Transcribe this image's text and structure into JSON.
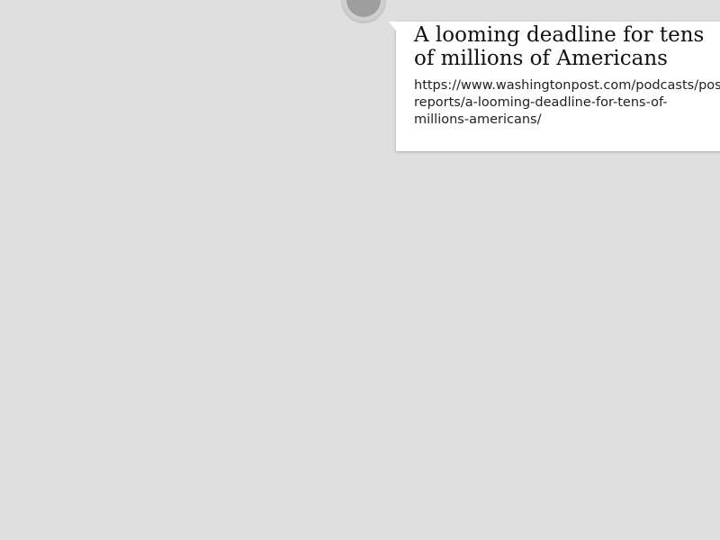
{
  "marker": {
    "icon": "circle-marker-icon",
    "outer_color": "#cfcfcf",
    "inner_color": "#9e9e9e"
  },
  "card": {
    "title": "A looming deadline for tens\nof millions of Americans",
    "url_display": "https://www.washingtonpost.com/podcasts/post\nreports/a-looming-deadline-for-tens-of-\nmillions-americans/"
  },
  "colors": {
    "background": "#dfdfdf",
    "card_background": "#ffffff"
  }
}
